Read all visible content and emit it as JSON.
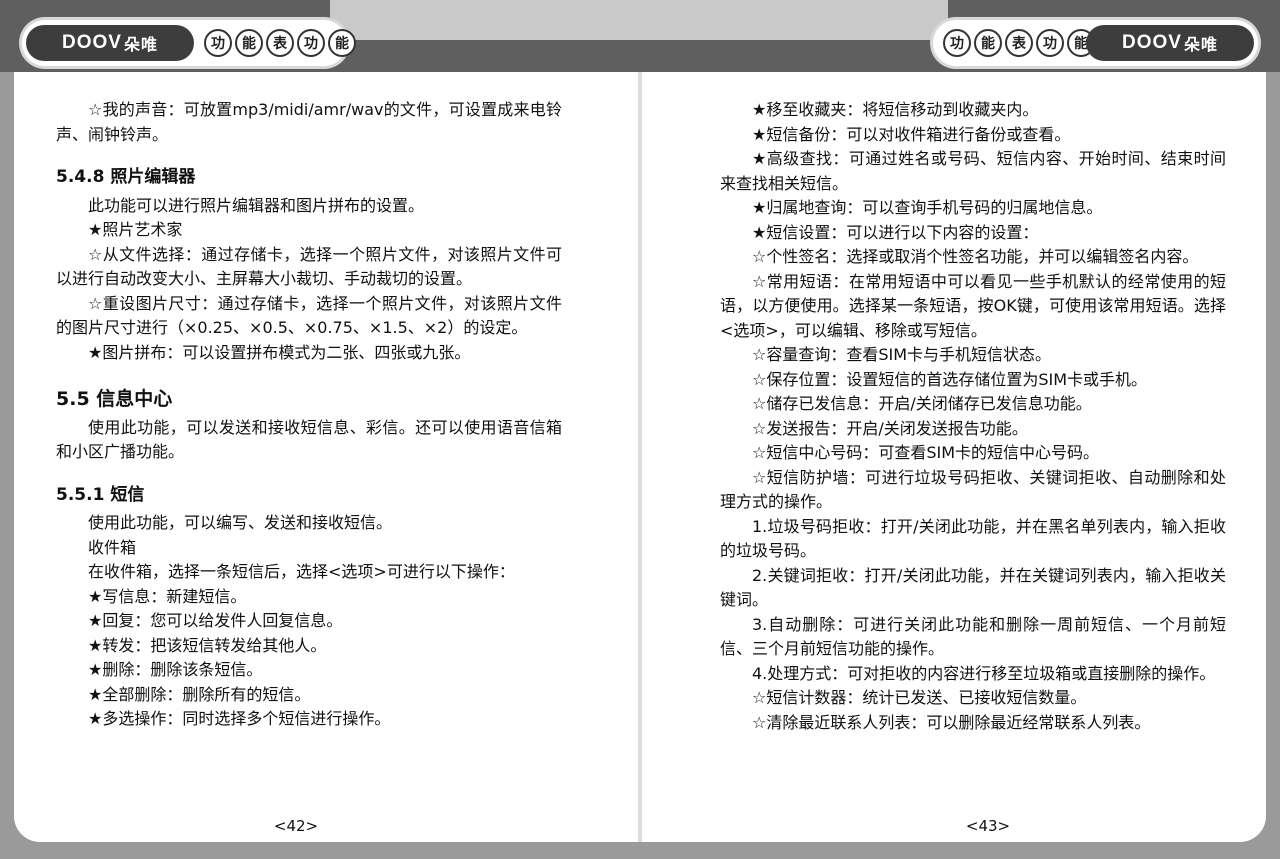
{
  "header": {
    "logo_text": "DOOV",
    "logo_cn": "朵唯",
    "section_chars": [
      "功",
      "能",
      "表",
      "功",
      "能"
    ]
  },
  "left_page": {
    "blocks": [
      {
        "type": "p",
        "text": "☆我的声音：可放置mp3/midi/amr/wav的文件，可设置成来电铃声、闹钟铃声。"
      },
      {
        "type": "h3",
        "text": "5.4.8 照片编辑器"
      },
      {
        "type": "p",
        "text": "此功能可以进行照片编辑器和图片拼布的设置。"
      },
      {
        "type": "p",
        "text": "★照片艺术家"
      },
      {
        "type": "p",
        "text": "☆从文件选择：通过存储卡，选择一个照片文件，对该照片文件可以进行自动改变大小、主屏幕大小裁切、手动裁切的设置。"
      },
      {
        "type": "p",
        "text": "☆重设图片尺寸：通过存储卡，选择一个照片文件，对该照片文件的图片尺寸进行（×0.25、×0.5、×0.75、×1.5、×2）的设定。"
      },
      {
        "type": "p",
        "text": "★图片拼布：可以设置拼布模式为二张、四张或九张。"
      },
      {
        "type": "h2",
        "text": "5.5 信息中心"
      },
      {
        "type": "p",
        "text": "使用此功能，可以发送和接收短信息、彩信。还可以使用语音信箱和小区广播功能。"
      },
      {
        "type": "h3",
        "text": "5.5.1 短信"
      },
      {
        "type": "p",
        "text": "使用此功能，可以编写、发送和接收短信。"
      },
      {
        "type": "p",
        "text": "收件箱"
      },
      {
        "type": "p",
        "text": "在收件箱，选择一条短信后，选择<选项>可进行以下操作："
      },
      {
        "type": "p",
        "text": "★写信息：新建短信。"
      },
      {
        "type": "p",
        "text": "★回复：您可以给发件人回复信息。"
      },
      {
        "type": "p",
        "text": "★转发：把该短信转发给其他人。"
      },
      {
        "type": "p",
        "text": "★删除：删除该条短信。"
      },
      {
        "type": "p",
        "text": "★全部删除：删除所有的短信。"
      },
      {
        "type": "p",
        "text": "★多选操作：同时选择多个短信进行操作。"
      }
    ],
    "page_number": "<42>"
  },
  "right_page": {
    "blocks": [
      {
        "type": "p",
        "text": "★移至收藏夹：将短信移动到收藏夹内。"
      },
      {
        "type": "p",
        "text": "★短信备份：可以对收件箱进行备份或查看。"
      },
      {
        "type": "p",
        "text": "★高级查找：可通过姓名或号码、短信内容、开始时间、结束时间来查找相关短信。"
      },
      {
        "type": "p",
        "text": "★归属地查询：可以查询手机号码的归属地信息。"
      },
      {
        "type": "p",
        "text": "★短信设置：可以进行以下内容的设置："
      },
      {
        "type": "p",
        "text": "☆个性签名：选择或取消个性签名功能，并可以编辑签名内容。"
      },
      {
        "type": "p",
        "text": "☆常用短语：在常用短语中可以看见一些手机默认的经常使用的短语，以方便使用。选择某一条短语，按OK键，可使用该常用短语。选择<选项>，可以编辑、移除或写短信。"
      },
      {
        "type": "p",
        "text": "☆容量查询：查看SIM卡与手机短信状态。"
      },
      {
        "type": "p",
        "text": "☆保存位置：设置短信的首选存储位置为SIM卡或手机。"
      },
      {
        "type": "p",
        "text": "☆储存已发信息：开启/关闭储存已发信息功能。"
      },
      {
        "type": "p",
        "text": "☆发送报告：开启/关闭发送报告功能。"
      },
      {
        "type": "p",
        "text": "☆短信中心号码：可查看SIM卡的短信中心号码。"
      },
      {
        "type": "p",
        "text": "☆短信防护墙：可进行垃圾号码拒收、关键词拒收、自动删除和处理方式的操作。"
      },
      {
        "type": "p",
        "text": "1.垃圾号码拒收：打开/关闭此功能，并在黑名单列表内，输入拒收的垃圾号码。"
      },
      {
        "type": "p",
        "text": "2.关键词拒收：打开/关闭此功能，并在关键词列表内，输入拒收关键词。"
      },
      {
        "type": "p",
        "text": "3.自动删除：可进行关闭此功能和删除一周前短信、一个月前短信、三个月前短信功能的操作。"
      },
      {
        "type": "p",
        "text": "4.处理方式：可对拒收的内容进行移至垃圾箱或直接删除的操作。"
      },
      {
        "type": "p",
        "text": "☆短信计数器：统计已发送、已接收短信数量。"
      },
      {
        "type": "p",
        "text": "☆清除最近联系人列表：可以删除最近经常联系人列表。"
      }
    ],
    "page_number": "<43>"
  }
}
